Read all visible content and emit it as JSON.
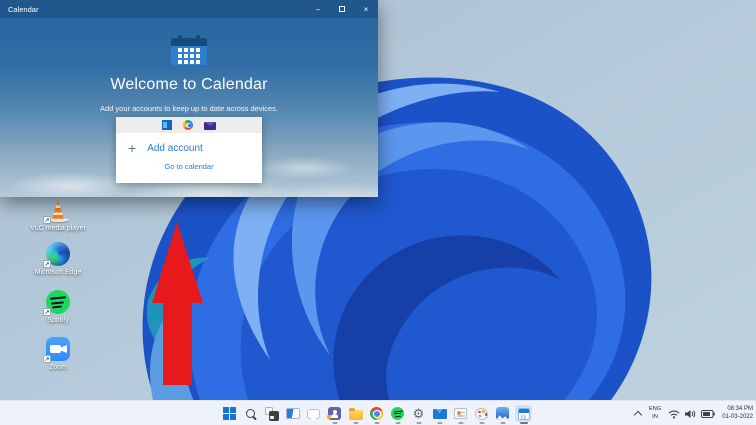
{
  "calendar_window": {
    "title": "Calendar",
    "controls": {
      "minimize": "–",
      "close": "×"
    },
    "heading": "Welcome to Calendar",
    "subtitle": "Add your accounts to keep up to date across devices.",
    "providers": [
      "outlook",
      "google",
      "other-mail"
    ],
    "plus": "+",
    "add_account": "Add account",
    "go_to_calendar": "Go to calendar"
  },
  "desktop": {
    "icons": [
      {
        "name": "vlc-media-player",
        "label": "VLC media player"
      },
      {
        "name": "microsoft-edge",
        "label": "Microsoft Edge"
      },
      {
        "name": "spotify",
        "label": "Spotify"
      },
      {
        "name": "zoom",
        "label": "Zoom"
      }
    ],
    "annotation": "red-up-arrow"
  },
  "taskbar": {
    "icons": [
      "start",
      "search",
      "task-view",
      "widgets",
      "chat",
      "teams",
      "file-explorer",
      "chrome",
      "spotify",
      "settings",
      "mail",
      "photo-viewer",
      "paint",
      "photos",
      "calendar"
    ],
    "active_icon": "calendar",
    "tray": {
      "language_top": "ENG",
      "language_bottom": "IN",
      "glyphs": [
        "wifi",
        "volume",
        "battery"
      ],
      "time": "08:34 PM",
      "date": "01-03-2022"
    }
  },
  "colors": {
    "titlebar": "#20588d",
    "link_blue": "#2b7cd3",
    "arrow_red": "#e8191b",
    "taskbar_bg": "#eff3f9",
    "wallpaper_base": "#b3c8d8",
    "bloom_blue": "#2e6ae0"
  }
}
